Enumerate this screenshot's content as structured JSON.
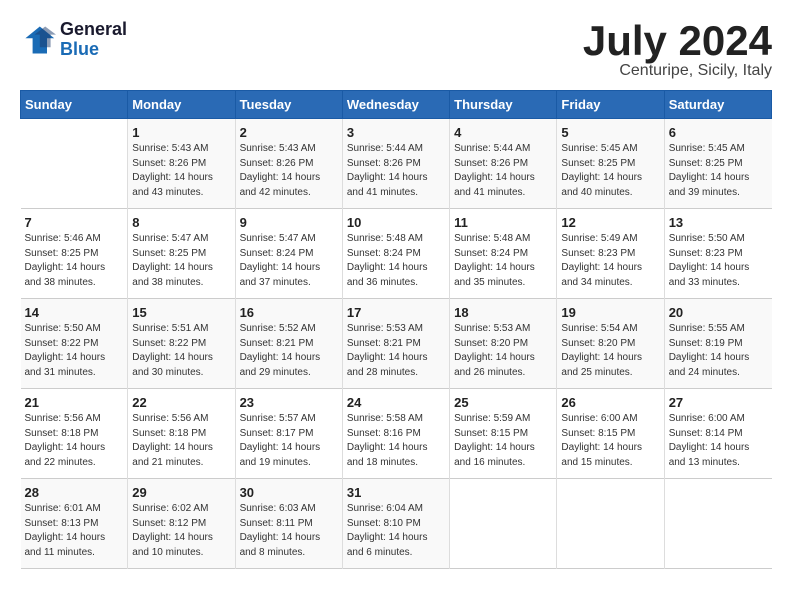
{
  "header": {
    "logo_line1": "General",
    "logo_line2": "Blue",
    "month_title": "July 2024",
    "location": "Centuripe, Sicily, Italy"
  },
  "weekdays": [
    "Sunday",
    "Monday",
    "Tuesday",
    "Wednesday",
    "Thursday",
    "Friday",
    "Saturday"
  ],
  "weeks": [
    [
      {
        "day": "",
        "info": ""
      },
      {
        "day": "1",
        "info": "Sunrise: 5:43 AM\nSunset: 8:26 PM\nDaylight: 14 hours\nand 43 minutes."
      },
      {
        "day": "2",
        "info": "Sunrise: 5:43 AM\nSunset: 8:26 PM\nDaylight: 14 hours\nand 42 minutes."
      },
      {
        "day": "3",
        "info": "Sunrise: 5:44 AM\nSunset: 8:26 PM\nDaylight: 14 hours\nand 41 minutes."
      },
      {
        "day": "4",
        "info": "Sunrise: 5:44 AM\nSunset: 8:26 PM\nDaylight: 14 hours\nand 41 minutes."
      },
      {
        "day": "5",
        "info": "Sunrise: 5:45 AM\nSunset: 8:25 PM\nDaylight: 14 hours\nand 40 minutes."
      },
      {
        "day": "6",
        "info": "Sunrise: 5:45 AM\nSunset: 8:25 PM\nDaylight: 14 hours\nand 39 minutes."
      }
    ],
    [
      {
        "day": "7",
        "info": "Sunrise: 5:46 AM\nSunset: 8:25 PM\nDaylight: 14 hours\nand 38 minutes."
      },
      {
        "day": "8",
        "info": "Sunrise: 5:47 AM\nSunset: 8:25 PM\nDaylight: 14 hours\nand 38 minutes."
      },
      {
        "day": "9",
        "info": "Sunrise: 5:47 AM\nSunset: 8:24 PM\nDaylight: 14 hours\nand 37 minutes."
      },
      {
        "day": "10",
        "info": "Sunrise: 5:48 AM\nSunset: 8:24 PM\nDaylight: 14 hours\nand 36 minutes."
      },
      {
        "day": "11",
        "info": "Sunrise: 5:48 AM\nSunset: 8:24 PM\nDaylight: 14 hours\nand 35 minutes."
      },
      {
        "day": "12",
        "info": "Sunrise: 5:49 AM\nSunset: 8:23 PM\nDaylight: 14 hours\nand 34 minutes."
      },
      {
        "day": "13",
        "info": "Sunrise: 5:50 AM\nSunset: 8:23 PM\nDaylight: 14 hours\nand 33 minutes."
      }
    ],
    [
      {
        "day": "14",
        "info": "Sunrise: 5:50 AM\nSunset: 8:22 PM\nDaylight: 14 hours\nand 31 minutes."
      },
      {
        "day": "15",
        "info": "Sunrise: 5:51 AM\nSunset: 8:22 PM\nDaylight: 14 hours\nand 30 minutes."
      },
      {
        "day": "16",
        "info": "Sunrise: 5:52 AM\nSunset: 8:21 PM\nDaylight: 14 hours\nand 29 minutes."
      },
      {
        "day": "17",
        "info": "Sunrise: 5:53 AM\nSunset: 8:21 PM\nDaylight: 14 hours\nand 28 minutes."
      },
      {
        "day": "18",
        "info": "Sunrise: 5:53 AM\nSunset: 8:20 PM\nDaylight: 14 hours\nand 26 minutes."
      },
      {
        "day": "19",
        "info": "Sunrise: 5:54 AM\nSunset: 8:20 PM\nDaylight: 14 hours\nand 25 minutes."
      },
      {
        "day": "20",
        "info": "Sunrise: 5:55 AM\nSunset: 8:19 PM\nDaylight: 14 hours\nand 24 minutes."
      }
    ],
    [
      {
        "day": "21",
        "info": "Sunrise: 5:56 AM\nSunset: 8:18 PM\nDaylight: 14 hours\nand 22 minutes."
      },
      {
        "day": "22",
        "info": "Sunrise: 5:56 AM\nSunset: 8:18 PM\nDaylight: 14 hours\nand 21 minutes."
      },
      {
        "day": "23",
        "info": "Sunrise: 5:57 AM\nSunset: 8:17 PM\nDaylight: 14 hours\nand 19 minutes."
      },
      {
        "day": "24",
        "info": "Sunrise: 5:58 AM\nSunset: 8:16 PM\nDaylight: 14 hours\nand 18 minutes."
      },
      {
        "day": "25",
        "info": "Sunrise: 5:59 AM\nSunset: 8:15 PM\nDaylight: 14 hours\nand 16 minutes."
      },
      {
        "day": "26",
        "info": "Sunrise: 6:00 AM\nSunset: 8:15 PM\nDaylight: 14 hours\nand 15 minutes."
      },
      {
        "day": "27",
        "info": "Sunrise: 6:00 AM\nSunset: 8:14 PM\nDaylight: 14 hours\nand 13 minutes."
      }
    ],
    [
      {
        "day": "28",
        "info": "Sunrise: 6:01 AM\nSunset: 8:13 PM\nDaylight: 14 hours\nand 11 minutes."
      },
      {
        "day": "29",
        "info": "Sunrise: 6:02 AM\nSunset: 8:12 PM\nDaylight: 14 hours\nand 10 minutes."
      },
      {
        "day": "30",
        "info": "Sunrise: 6:03 AM\nSunset: 8:11 PM\nDaylight: 14 hours\nand 8 minutes."
      },
      {
        "day": "31",
        "info": "Sunrise: 6:04 AM\nSunset: 8:10 PM\nDaylight: 14 hours\nand 6 minutes."
      },
      {
        "day": "",
        "info": ""
      },
      {
        "day": "",
        "info": ""
      },
      {
        "day": "",
        "info": ""
      }
    ]
  ]
}
